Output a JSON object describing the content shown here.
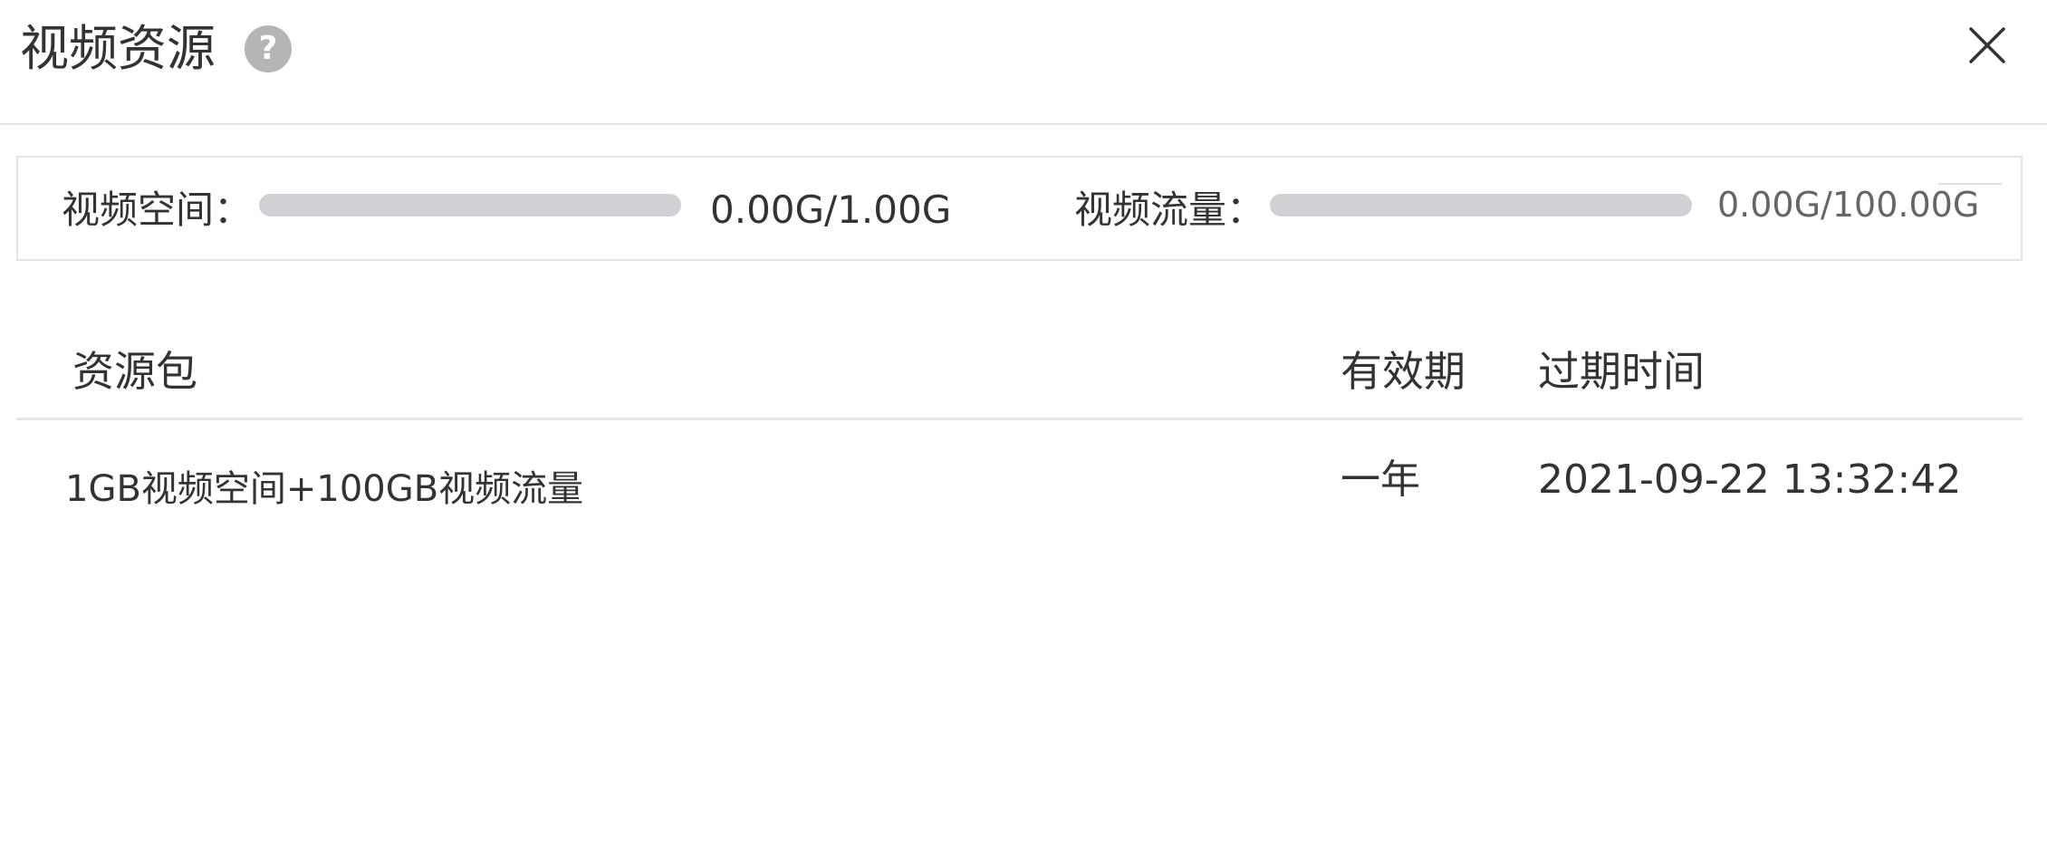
{
  "dialog": {
    "title": "视频资源",
    "help_icon": "question-circle-icon",
    "help_glyph": "?",
    "close_icon": "close-x-icon"
  },
  "usage": {
    "space": {
      "label": "视频空间：",
      "value": "0.00G/1.00G",
      "used_fraction": 0.0
    },
    "traffic": {
      "label": "视频流量：",
      "value": "0.00G/100.00G",
      "used_fraction": 0.0
    },
    "colors": {
      "track": "#d0d1d4",
      "fill": "#4a90e2"
    }
  },
  "table": {
    "columns": [
      "资源包",
      "有效期",
      "过期时间"
    ],
    "rows": [
      {
        "package": "1GB视频空间+100GB视频流量",
        "validity": "一年",
        "expires": "2021-09-22 13:32:42"
      }
    ]
  }
}
